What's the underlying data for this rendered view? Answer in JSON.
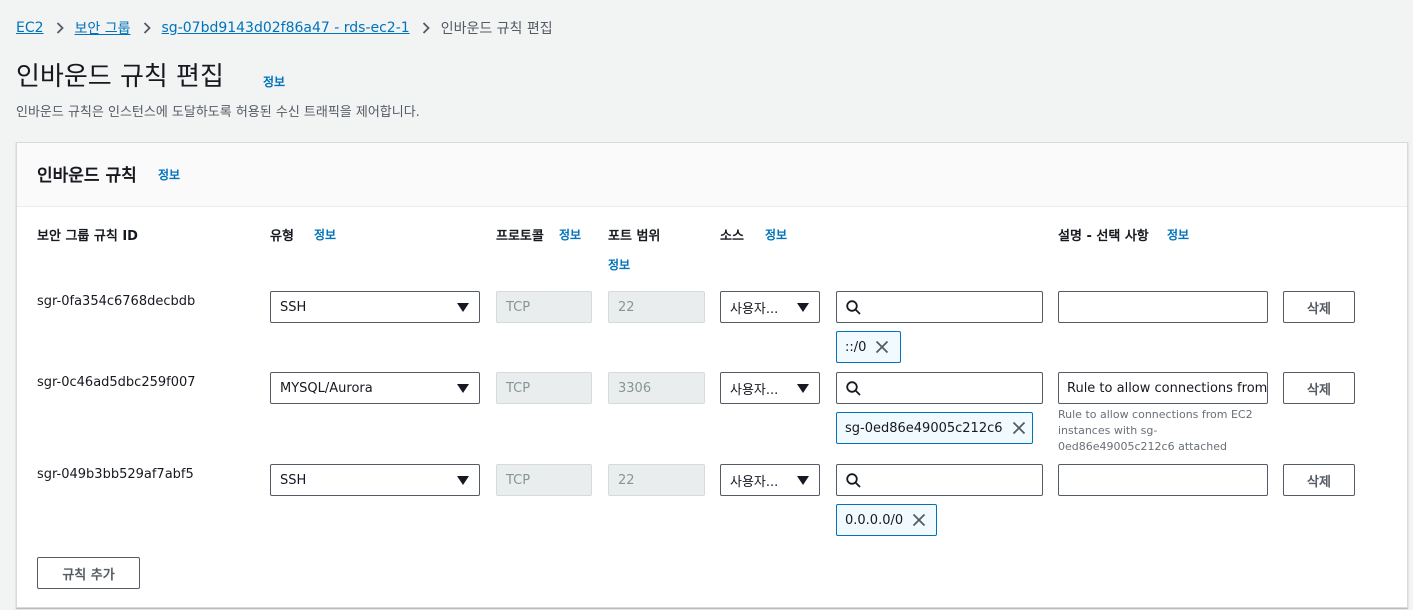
{
  "breadcrumb": {
    "items": [
      "EC2",
      "보안 그룹",
      "sg-07bd9143d02f86a47 - rds-ec2-1"
    ],
    "current": "인바운드 규칙 편집"
  },
  "page": {
    "title": "인바운드 규칙 편집",
    "info": "정보",
    "description": "인바운드 규칙은 인스턴스에 도달하도록 허용된 수신 트래픽을 제어합니다."
  },
  "panel": {
    "title": "인바운드 규칙",
    "info": "정보"
  },
  "columns": {
    "rule_id": "보안 그룹 규칙 ID",
    "type": "유형",
    "protocol": "프로토콜",
    "port_range": "포트 범위",
    "source": "소스",
    "description": "설명 - 선택 사항",
    "info": "정보"
  },
  "rules": [
    {
      "id": "sgr-0fa354c6768decbdb",
      "type": "SSH",
      "protocol": "TCP",
      "port": "22",
      "source": "사용자...",
      "token": "::/0",
      "description": "",
      "hint": "",
      "delete": "삭제"
    },
    {
      "id": "sgr-0c46ad5dbc259f007",
      "type": "MYSQL/Aurora",
      "protocol": "TCP",
      "port": "3306",
      "source": "사용자...",
      "token": "sg-0ed86e49005c212c6",
      "description": "Rule to allow connections from EC2 instances with sg-0ed86e49005c212c6 attached",
      "hint": "Rule to allow connections from EC2 instances with sg-0ed86e49005c212c6 attached",
      "delete": "삭제"
    },
    {
      "id": "sgr-049b3bb529af7abf5",
      "type": "SSH",
      "protocol": "TCP",
      "port": "22",
      "source": "사용자...",
      "token": "0.0.0.0/0",
      "description": "",
      "hint": "",
      "delete": "삭제"
    }
  ],
  "add_rule": "규칙 추가",
  "colors": {
    "link": "#0073bb",
    "token_border": "#0073bb",
    "token_bg": "#f1faff",
    "disabled_bg": "#eaeded",
    "page_bg": "#f2f3f3"
  },
  "icons": [
    "chevron-right-icon",
    "caret-down-icon",
    "search-icon",
    "close-icon"
  ]
}
